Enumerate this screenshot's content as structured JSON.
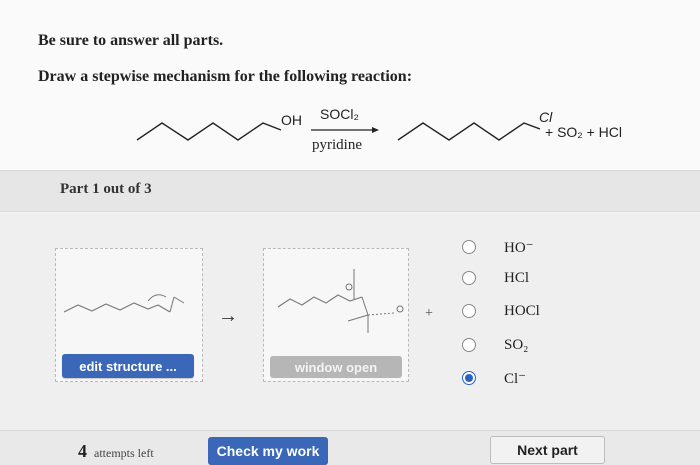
{
  "instructions": {
    "line1": "Be sure to answer all parts.",
    "line2": "Draw a stepwise mechanism for the following reaction:"
  },
  "reaction": {
    "reactant_group": "OH",
    "reagent_top": "SOCl₂",
    "reagent_bottom": "pyridine",
    "product_group": "Cl",
    "byproducts": "+ SO₂ + HCl"
  },
  "part": {
    "label": "Part 1 out of 3"
  },
  "canvas": {
    "edit_button": "edit structure ...",
    "window_button": "window open",
    "arrow": "→",
    "plus": "+"
  },
  "choices": [
    {
      "label": "HO⁻",
      "selected": false
    },
    {
      "label": "HCl",
      "selected": false
    },
    {
      "label": "HOCl",
      "selected": false
    },
    {
      "label": "SO₂",
      "selected": false
    },
    {
      "label": "Cl⁻",
      "selected": true
    }
  ],
  "footer": {
    "attempts_count": "4",
    "attempts_text": "attempts left",
    "check_button": "Check my work",
    "next_button": "Next part"
  },
  "colors": {
    "accent": "#3a67b7",
    "radio_selected": "#2b62c9"
  }
}
